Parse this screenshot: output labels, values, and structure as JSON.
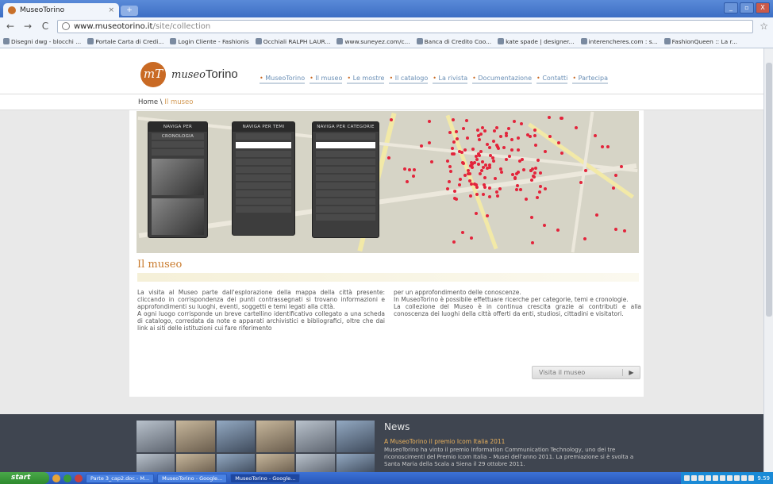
{
  "browser": {
    "tab_title": "MuseoTorino",
    "tab_close": "×",
    "new_tab": "+",
    "url_host": "www.museotorino.it",
    "url_path": "/site/collection",
    "window_buttons": [
      "_",
      "▫",
      "X"
    ],
    "back": "←",
    "forward": "→",
    "reload": "C",
    "star": "☆"
  },
  "bookmarks": [
    "Disegni dwg - blocchi ...",
    "Portale Carta di Credi...",
    "Login Cliente - Fashionis",
    "Occhiali RALPH LAUR...",
    "www.suneyez.com/c...",
    "Banca di Credito Coo...",
    "kate spade | designer...",
    "interencheres.com : s...",
    "FashionQueen :: La r..."
  ],
  "site": {
    "logo_mark": "mT",
    "logo_italic": "museo",
    "logo_rest": "Torino",
    "nav": [
      "MuseoTorino",
      "Il museo",
      "Le mostre",
      "Il catalogo",
      "La rivista",
      "Documentazione",
      "Contatti",
      "Partecipa"
    ],
    "breadcrumb_home": "Home",
    "breadcrumb_sep": " \\ ",
    "breadcrumb_current": "Il museo"
  },
  "panels": [
    {
      "title": "NAVIGA PER CRONOLOGIA"
    },
    {
      "title": "NAVIGA PER TEMI"
    },
    {
      "title": "NAVIGA PER CATEGORIE"
    }
  ],
  "main": {
    "title": "Il museo",
    "col1": "La visita al Museo parte dall'esplorazione della mappa della città presente: cliccando in corrispondenza dei punti contrassegnati si trovano informazioni e approfondimenti su luoghi, eventi, soggetti e temi legati alla città.\nA ogni luogo corrisponde un breve cartellino identificativo collegato a una scheda di catalogo, corredata da note e apparati archivistici e bibliografici, oltre che dai link ai siti delle istituzioni cui fare riferimento",
    "col2": "per un approfondimento delle conoscenze.\nIn MuseoTorino è possibile effettuare ricerche per categorie, temi e cronologie.\nLa collezione del Museo è in continua crescita grazie ai contributi e alla conoscenza dei luoghi della città offerti da enti, studiosi, cittadini e visitatori.",
    "visit_button": "Visita il museo",
    "visit_arrow": "▶"
  },
  "news": {
    "title": "News",
    "headline": "A MuseoTorino il premio Icom Italia 2011",
    "body": "MuseoTorino ha vinto il premio Information Communication Technology, uno dei tre riconoscimenti del Premio Icom Italia – Musei dell'anno 2011. La premiazione si è svolta a Santa Maria della Scala a Siena il 29 ottobre 2011."
  },
  "taskbar": {
    "start": "start",
    "tasks": [
      "Parte 3_cap2.doc - M...",
      "MuseoTorino - Google...",
      "MuseoTorino - Google..."
    ],
    "time": "9.59"
  }
}
